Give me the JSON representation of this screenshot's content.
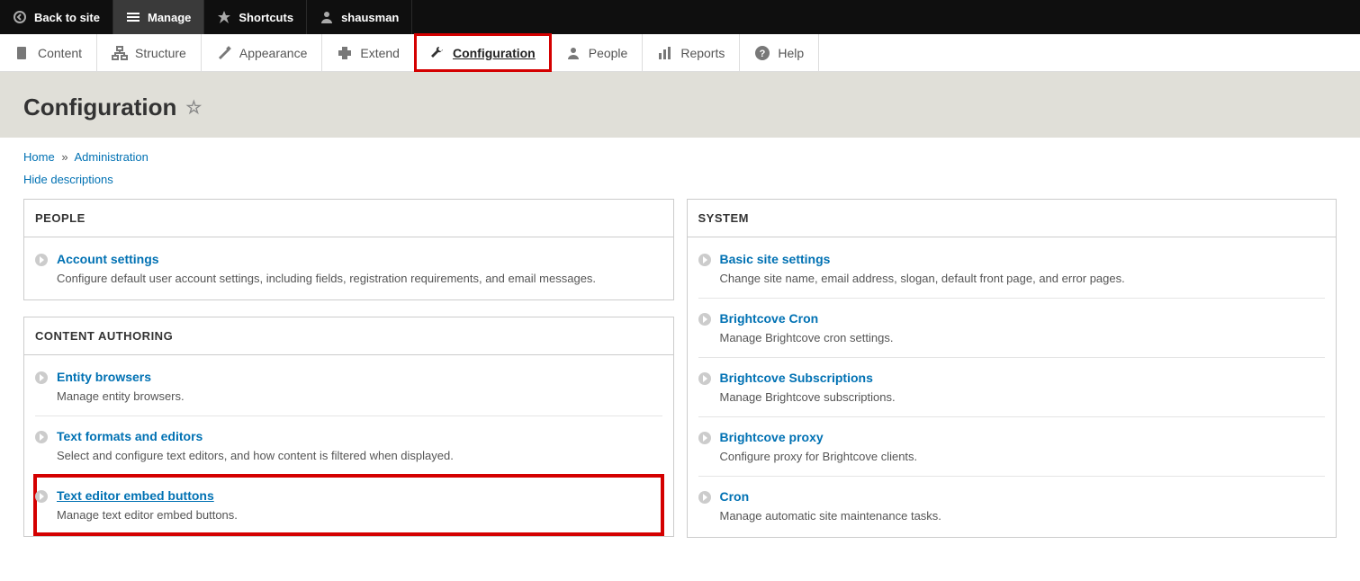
{
  "toolbar": {
    "back": "Back to site",
    "manage": "Manage",
    "shortcuts": "Shortcuts",
    "user": "shausman"
  },
  "menu": [
    {
      "label": "Content"
    },
    {
      "label": "Structure"
    },
    {
      "label": "Appearance"
    },
    {
      "label": "Extend"
    },
    {
      "label": "Configuration",
      "active": true
    },
    {
      "label": "People"
    },
    {
      "label": "Reports"
    },
    {
      "label": "Help"
    }
  ],
  "page": {
    "title": "Configuration",
    "breadcrumb": {
      "home": "Home",
      "admin": "Administration"
    },
    "hide_desc": "Hide descriptions"
  },
  "panels": {
    "people": {
      "title": "PEOPLE",
      "items": [
        {
          "title": "Account settings",
          "desc": "Configure default user account settings, including fields, registration requirements, and email messages."
        }
      ]
    },
    "content_authoring": {
      "title": "CONTENT AUTHORING",
      "items": [
        {
          "title": "Entity browsers",
          "desc": "Manage entity browsers."
        },
        {
          "title": "Text formats and editors",
          "desc": "Select and configure text editors, and how content is filtered when displayed."
        },
        {
          "title": "Text editor embed buttons",
          "desc": "Manage text editor embed buttons.",
          "highlight": true
        }
      ]
    },
    "system": {
      "title": "SYSTEM",
      "items": [
        {
          "title": "Basic site settings",
          "desc": "Change site name, email address, slogan, default front page, and error pages."
        },
        {
          "title": "Brightcove Cron",
          "desc": "Manage Brightcove cron settings."
        },
        {
          "title": "Brightcove Subscriptions",
          "desc": "Manage Brightcove subscriptions."
        },
        {
          "title": "Brightcove proxy",
          "desc": "Configure proxy for Brightcove clients."
        },
        {
          "title": "Cron",
          "desc": "Manage automatic site maintenance tasks."
        }
      ]
    }
  }
}
